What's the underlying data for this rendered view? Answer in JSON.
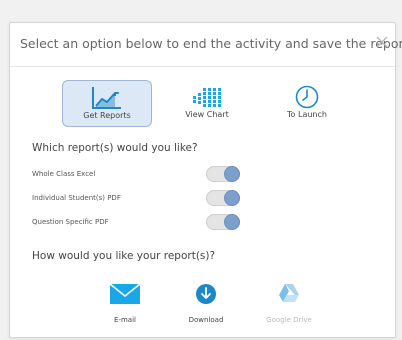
{
  "dialog": {
    "title": "Select an option below to end the activity and save the reports.",
    "close_icon": "close-icon"
  },
  "options": [
    {
      "label": "Get Reports",
      "icon": "trend-chart-icon",
      "selected": true
    },
    {
      "label": "View Chart",
      "icon": "bar-chart-icon",
      "selected": false
    },
    {
      "label": "To Launch",
      "icon": "clock-icon",
      "selected": false
    }
  ],
  "reports": {
    "question": "Which report(s) would you like?",
    "items": [
      {
        "label": "Whole Class Excel",
        "enabled": true
      },
      {
        "label": "Individual Student(s) PDF",
        "enabled": true
      },
      {
        "label": "Question Specific PDF",
        "enabled": true
      }
    ]
  },
  "delivery": {
    "question": "How would you like your report(s)?",
    "methods": [
      {
        "label": "E-mail",
        "icon": "mail-icon",
        "disabled": false
      },
      {
        "label": "Download",
        "icon": "download-icon",
        "disabled": false
      },
      {
        "label": "Google Drive",
        "icon": "google-drive-icon",
        "disabled": true
      }
    ]
  },
  "colors": {
    "accent": "#1e87c8",
    "selected_bg": "#dde8f6",
    "toggle_knob": "#7d9fcb",
    "disabled_text": "#bbbbbb"
  }
}
